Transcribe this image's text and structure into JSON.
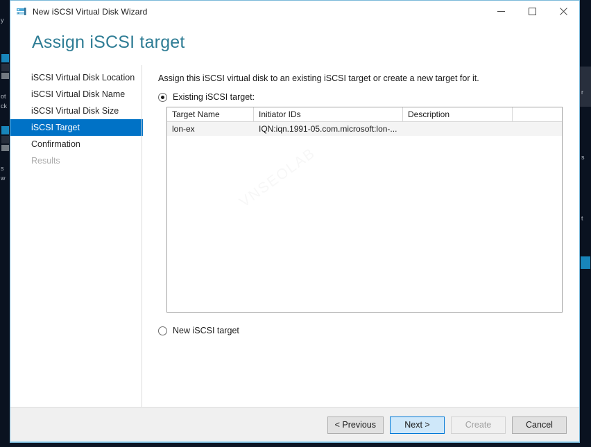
{
  "window": {
    "title": "New iSCSI Virtual Disk Wizard",
    "icon": "iscsi-disk-icon",
    "controls": {
      "minimize": "minimize-icon",
      "maximize": "maximize-icon",
      "close": "close-icon"
    }
  },
  "header": {
    "page_title": "Assign iSCSI target",
    "title_color": "#2f7d95"
  },
  "sidebar": {
    "items": [
      {
        "label": "iSCSI Virtual Disk Location",
        "state": "normal"
      },
      {
        "label": "iSCSI Virtual Disk Name",
        "state": "normal"
      },
      {
        "label": "iSCSI Virtual Disk Size",
        "state": "normal"
      },
      {
        "label": "iSCSI Target",
        "state": "selected"
      },
      {
        "label": "Confirmation",
        "state": "normal"
      },
      {
        "label": "Results",
        "state": "disabled"
      }
    ],
    "selected_color": "#0072c6"
  },
  "content": {
    "intro": "Assign this iSCSI virtual disk to an existing iSCSI target or create a new target for it.",
    "existing_option": {
      "label": "Existing iSCSI target:",
      "checked": true
    },
    "new_option": {
      "label": "New iSCSI target",
      "checked": false
    },
    "watermark": "VNSEOLAB",
    "table": {
      "columns": [
        "Target Name",
        "Initiator IDs",
        "Description"
      ],
      "rows": [
        {
          "target_name": "lon-ex",
          "initiator_ids": "IQN:iqn.1991-05.com.microsoft:lon-...",
          "description": ""
        }
      ]
    }
  },
  "footer": {
    "previous": "< Previous",
    "next": "Next >",
    "create": "Create",
    "cancel": "Cancel",
    "next_is_default": true,
    "create_disabled": true
  },
  "background": {
    "left_labels": [
      "y",
      "ot",
      "ck",
      "s",
      "w"
    ],
    "right_labels": [
      "r",
      "s",
      "t"
    ]
  }
}
